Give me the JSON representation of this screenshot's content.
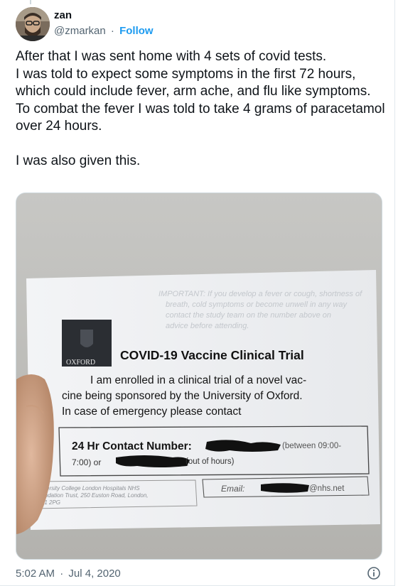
{
  "tweet": {
    "author": {
      "display_name": "zan",
      "handle": "@zmarkan",
      "separator": "·",
      "follow_label": "Follow"
    },
    "text": "After that I was sent home with 4 sets of covid tests.\nI was told to expect some symptoms in the first 72 hours, which could include fever, arm ache, and flu like symptoms.\nTo combat the fever I was told to take 4 grams of paracetamol over 24 hours.\n\nI was also given this.",
    "timestamp": {
      "time": "5:02 AM",
      "separator": "·",
      "date": "Jul 4, 2020"
    },
    "info_icon": "info-circle-icon",
    "link_color": "#1d9bf0"
  },
  "photo_card": {
    "logo_text": "OXFORD",
    "title": "COVID-19 Vaccine Clinical Trial",
    "body_lines": [
      "I am enrolled in a clinical trial of a novel vac-",
      "cine being sponsored by the University of Oxford.",
      "In case of emergency please contact"
    ],
    "contact_label": "24 Hr Contact Number:",
    "contact_hours": "(between 09:00-",
    "contact_line2_start": "7:00) or",
    "contact_out_of_hours": "(out of hours)",
    "email_label": "Email:",
    "email_domain": "@nhs.net",
    "footer_lines": [
      "University College London Hospitals NHS",
      "Foundation Trust, 250 Euston Road, London,",
      "NW1 2PG"
    ],
    "back_text_lines": [
      "IMPORTANT: If you develop a fever or cough, shortness of",
      "breath, cold symptoms or become unwell in any way",
      "contact the study team on the number above on",
      "advice before attending."
    ]
  }
}
